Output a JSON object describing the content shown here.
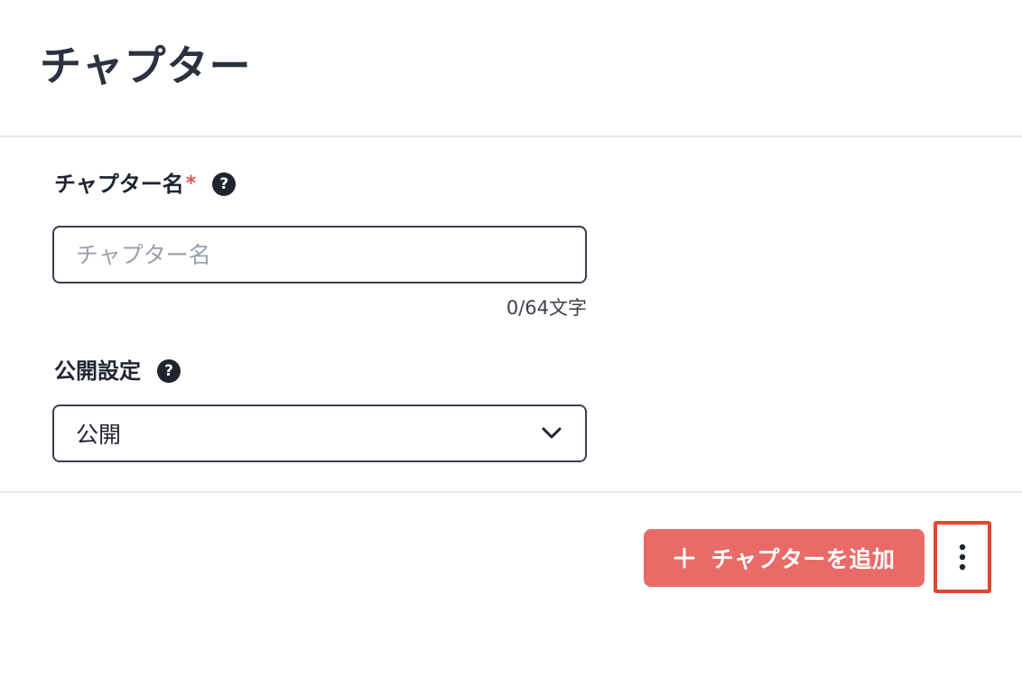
{
  "header": {
    "title": "チャプター"
  },
  "form": {
    "name_field": {
      "label": "チャプター名",
      "required_mark": "*",
      "help_icon": "?",
      "placeholder": "チャプター名",
      "value": "",
      "char_count": "0/64文字"
    },
    "visibility_field": {
      "label": "公開設定",
      "help_icon": "?",
      "selected": "公開"
    }
  },
  "actions": {
    "add_chapter_label": "チャプターを追加",
    "more_icon": "more-vertical-icon",
    "add_icon": "plus-icon"
  },
  "colors": {
    "accent": "#e86b68",
    "highlight_border": "#e2462f",
    "text": "#1f2430",
    "divider": "#e8e9ec"
  }
}
